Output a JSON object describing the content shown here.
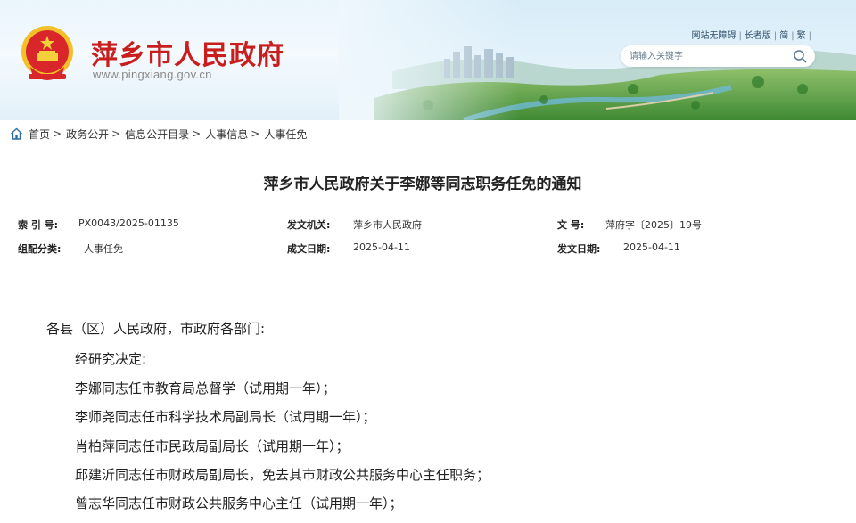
{
  "header": {
    "site_title": "萍乡市人民政府",
    "site_url": "www.pingxiang.gov.cn",
    "top_links": [
      "网站无障碍",
      "长者版",
      "简",
      "繁"
    ],
    "search_placeholder": "请输入关键字",
    "emblem_icon": "national-emblem-icon",
    "search_icon": "search-icon",
    "colors": {
      "title_red": "#c81e1e",
      "sky": "#eaf5fc",
      "greenery": "#4f9a3a"
    }
  },
  "breadcrumb": {
    "home_icon": "home-icon",
    "items": [
      "首页",
      "政务公开",
      "信息公开目录",
      "人事信息",
      "人事任免"
    ]
  },
  "document": {
    "title": "萍乡市人民政府关于李娜等同志职务任免的通知",
    "meta": {
      "index_label": "索 引 号:",
      "index_value": "PX0043/2025-01135",
      "issuer_label": "发文机关:",
      "issuer_value": "萍乡市人民政府",
      "docno_label": "文    号:",
      "docno_value": "萍府字〔2025〕19号",
      "category_label": "组配分类:",
      "category_value": "人事任免",
      "created_label": "成文日期:",
      "created_value": "2025-04-11",
      "issued_label": "发文日期:",
      "issued_value": "2025-04-11"
    },
    "body": {
      "salutation": "各县（区）人民政府，市政府各部门:",
      "paragraphs": [
        "经研究决定:",
        "李娜同志任市教育局总督学（试用期一年）；",
        "李师尧同志任市科学技术局副局长（试用期一年）；",
        "肖柏萍同志任市民政局副局长（试用期一年）；",
        "邱建沂同志任市财政局副局长，免去其市财政公共服务中心主任职务；",
        "曾志华同志任市财政公共服务中心主任（试用期一年）；"
      ]
    }
  }
}
